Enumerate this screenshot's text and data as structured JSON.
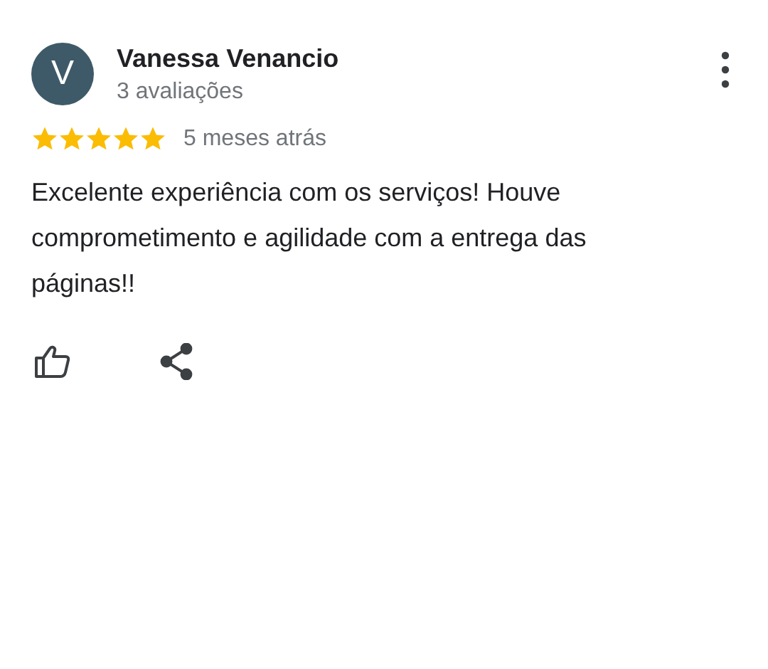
{
  "review": {
    "avatar_letter": "V",
    "author": "Vanessa Venancio",
    "author_meta": "3 avaliações",
    "stars": 5,
    "time": "5 meses atrás",
    "text": "Excelente experiência com os serviços! Houve comprometimento e agilidade com a entrega das páginas!!"
  }
}
